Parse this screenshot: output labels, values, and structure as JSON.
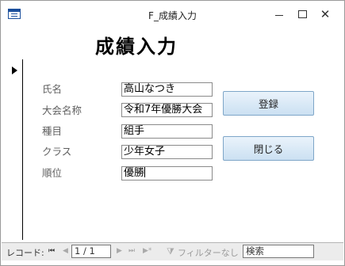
{
  "window": {
    "title": "F_成績入力",
    "minimize_symbol": "",
    "close_symbol": "✕"
  },
  "form": {
    "heading": "成績入力"
  },
  "fields": [
    {
      "label": "氏名",
      "value": "高山なつき"
    },
    {
      "label": "大会名称",
      "value": "令和7年優勝大会"
    },
    {
      "label": "種目",
      "value": "組手"
    },
    {
      "label": "クラス",
      "value": "少年女子"
    },
    {
      "label": "順位",
      "value": "優勝"
    }
  ],
  "buttons": {
    "register": "登録",
    "close": "閉じる"
  },
  "navigation": {
    "label": "レコード:",
    "first": "⏮",
    "prev": "◀",
    "count": "1 / 1",
    "next": "▶",
    "last": "⏭",
    "new": "▶*",
    "filter": "フィルターなし",
    "search": "検索"
  }
}
